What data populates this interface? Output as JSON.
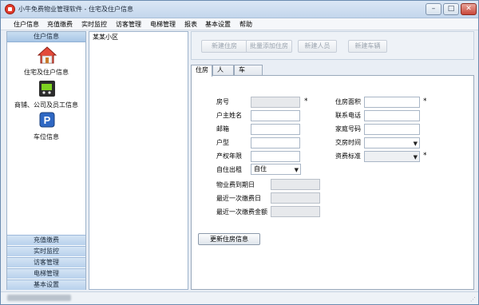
{
  "window": {
    "title": "小牛免费物业管理软件 - 住宅及住户信息",
    "minimize_label": "–",
    "maximize_label": "□",
    "close_label": "✕"
  },
  "menu": [
    "住户信息",
    "充值缴费",
    "实时监控",
    "访客管理",
    "电梯管理",
    "报表",
    "基本设置",
    "帮助"
  ],
  "nav": {
    "header": "住户信息",
    "items": [
      {
        "label": "住宅及住户信息",
        "icon": "house-icon"
      },
      {
        "label": "商铺、公司及员工信息",
        "icon": "shop-cart-icon"
      },
      {
        "label": "车位信息",
        "icon": "parking-icon"
      }
    ],
    "bottom": [
      "充值缴费",
      "实时监控",
      "访客管理",
      "电梯管理",
      "基本设置"
    ]
  },
  "tree": {
    "root": "某某小区"
  },
  "toolbar": {
    "new_house": "新建住房",
    "batch_add_house": "批量添加住房",
    "new_person": "新建人员",
    "new_vehicle": "新建车辆"
  },
  "tabs": [
    "住房",
    "人",
    "车"
  ],
  "form": {
    "room_no": {
      "label": "房号",
      "value": ""
    },
    "owner_name": {
      "label": "户主姓名",
      "value": ""
    },
    "email": {
      "label": "邮箱",
      "value": ""
    },
    "house_type": {
      "label": "户型",
      "value": ""
    },
    "property_years": {
      "label": "产权年限",
      "value": ""
    },
    "self_rent": {
      "label": "自住出租",
      "value": "自住"
    },
    "fee_due_date": {
      "label": "物业费到期日",
      "value": ""
    },
    "last_payment_date": {
      "label": "最近一次缴费日",
      "value": ""
    },
    "last_payment_amount": {
      "label": "最近一次缴费金额",
      "value": ""
    },
    "area": {
      "label": "住房面积",
      "value": ""
    },
    "phone": {
      "label": "联系电话",
      "value": ""
    },
    "home_phone": {
      "label": "家庭号码",
      "value": ""
    },
    "handover_date": {
      "label": "交房时间",
      "value": ""
    },
    "fee_standard": {
      "label": "资费标准",
      "value": ""
    },
    "required_mark": "*",
    "update_button": "更新住房信息"
  }
}
